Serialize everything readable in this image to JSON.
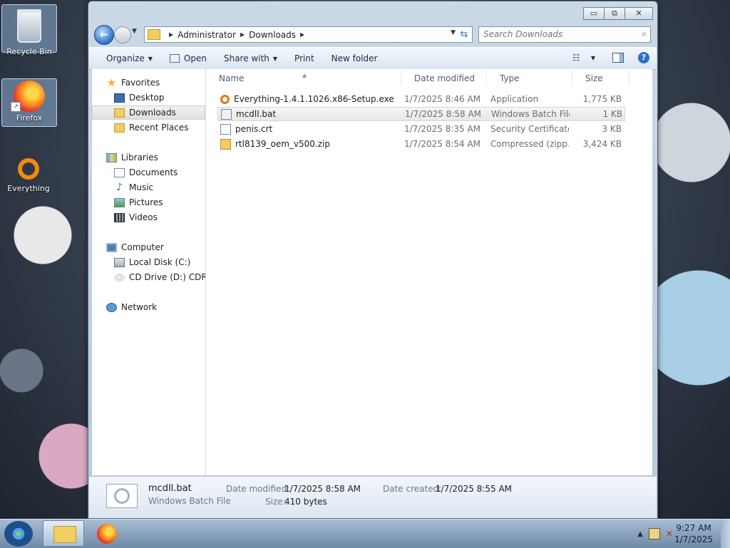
{
  "desktop": {
    "icons": [
      {
        "label": "Recycle Bin"
      },
      {
        "label": "Firefox"
      },
      {
        "label": "Everything"
      }
    ]
  },
  "window": {
    "controls": {
      "minimize": "▭",
      "maximize": "⧉",
      "close": "✕"
    },
    "address": {
      "crumbs": [
        "Administrator",
        "Downloads"
      ]
    },
    "search": {
      "placeholder": "Search Downloads"
    },
    "commands": {
      "organize": "Organize",
      "open": "Open",
      "share_with": "Share with",
      "print": "Print",
      "new_folder": "New folder"
    },
    "nav": {
      "favorites": "Favorites",
      "desktop": "Desktop",
      "downloads": "Downloads",
      "recent_places": "Recent Places",
      "libraries": "Libraries",
      "documents": "Documents",
      "music": "Music",
      "pictures": "Pictures",
      "videos": "Videos",
      "computer": "Computer",
      "local_disk": "Local Disk (C:)",
      "cd_drive": "CD Drive (D:) CDROM",
      "network": "Network"
    },
    "columns": {
      "name": "Name",
      "date": "Date modified",
      "type": "Type",
      "size": "Size"
    },
    "files": [
      {
        "name": "Everything-1.4.1.1026.x86-Setup.exe",
        "date": "1/7/2025 8:46 AM",
        "type": "Application",
        "size": "1,775 KB",
        "icon": "exe-icon"
      },
      {
        "name": "mcdll.bat",
        "date": "1/7/2025 8:58 AM",
        "type": "Windows Batch File",
        "size": "1 KB",
        "icon": "batch-file-icon"
      },
      {
        "name": "penis.crt",
        "date": "1/7/2025 8:35 AM",
        "type": "Security Certificate",
        "size": "3 KB",
        "icon": "certificate-icon"
      },
      {
        "name": "rtl8139_oem_v500.zip",
        "date": "1/7/2025 8:54 AM",
        "type": "Compressed (zipp...",
        "size": "3,424 KB",
        "icon": "zip-folder-icon"
      }
    ],
    "details": {
      "name": "mcdll.bat",
      "type": "Windows Batch File",
      "date_modified_label": "Date modified:",
      "date_modified": "1/7/2025 8:58 AM",
      "date_created_label": "Date created:",
      "date_created": "1/7/2025 8:55 AM",
      "size_label": "Size:",
      "size": "410 bytes"
    }
  },
  "taskbar": {
    "clock_time": "9:27 AM",
    "clock_date": "1/7/2025",
    "tray_arrow": "▲"
  }
}
